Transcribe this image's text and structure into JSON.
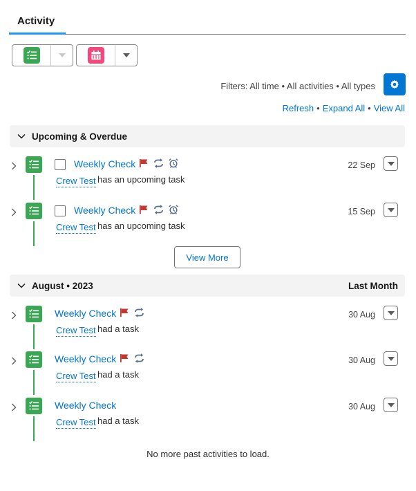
{
  "tabs": {
    "active": "Activity"
  },
  "toolbar": {
    "task_button_icon": "task-icon",
    "event_button_icon": "calendar-icon",
    "colors": {
      "task": "#3ba755",
      "event": "#f2487d"
    }
  },
  "filters": {
    "text": "Filters: All time • All activities • All types",
    "settings_icon": "gear-icon"
  },
  "links": {
    "refresh": "Refresh",
    "expand_all": "Expand All",
    "view_all": "View All",
    "separator": "•"
  },
  "sections": [
    {
      "title": "Upcoming & Overdue",
      "right_label": "",
      "items": [
        {
          "subject": "Weekly Check",
          "who": "Crew Test",
          "description": "has an upcoming task",
          "date": "22 Sep",
          "has_checkbox": true,
          "icons": [
            "flag-icon",
            "recurring-icon",
            "reminder-alarm-icon"
          ]
        },
        {
          "subject": "Weekly Check",
          "who": "Crew Test",
          "description": "has an upcoming task",
          "date": "15 Sep",
          "has_checkbox": true,
          "icons": [
            "flag-icon",
            "recurring-icon",
            "reminder-alarm-icon"
          ]
        }
      ],
      "view_more_label": "View More"
    },
    {
      "title": "August • 2023",
      "right_label": "Last Month",
      "items": [
        {
          "subject": "Weekly Check",
          "who": "Crew Test",
          "description": "had a task",
          "date": "30 Aug",
          "has_checkbox": false,
          "icons": [
            "flag-icon",
            "recurring-icon"
          ]
        },
        {
          "subject": "Weekly Check",
          "who": "Crew Test",
          "description": "had a task",
          "date": "30 Aug",
          "has_checkbox": false,
          "icons": [
            "flag-icon",
            "recurring-icon"
          ]
        },
        {
          "subject": "Weekly Check",
          "who": "Crew Test",
          "description": "had a task",
          "date": "30 Aug",
          "has_checkbox": false,
          "icons": []
        }
      ]
    }
  ],
  "footer": {
    "no_more": "No more past activities to load."
  },
  "colors": {
    "link": "#0176d3",
    "brand_button": "#0176d3",
    "flag": "#c23934",
    "icon_grey": "#5a6f8f",
    "timeline": "#3ba755"
  }
}
